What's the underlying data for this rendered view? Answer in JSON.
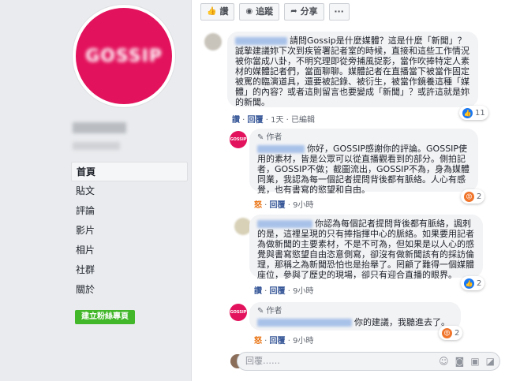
{
  "sidebar": {
    "logo_text": "GOSSIP",
    "items": [
      {
        "label": "首頁"
      },
      {
        "label": "貼文"
      },
      {
        "label": "評論"
      },
      {
        "label": "影片"
      },
      {
        "label": "相片"
      },
      {
        "label": "社群"
      },
      {
        "label": "關於"
      }
    ],
    "create_button": "建立粉絲專頁"
  },
  "toolbar": {
    "like": "讚",
    "follow": "追蹤",
    "share": "分享",
    "more": "···"
  },
  "comments": [
    {
      "text": "請問Gossip是什麼媒體？這是什麼「新聞」？誠摯建議妳下次到疾管署記者室的時候，直接和這些工作情況被你當成八卦，不明究理即從旁捕風捉影，當作吹捧特定人素材的媒體記者們，當面聊聊。媒體記者在直播當下被當作固定被罵的臨演道具，還要被記錄、被衍生，被當作鏡養這種「媒體」的內容？或者這則留言也要變成「新聞」？或許這就是妳的新聞。",
      "meta_like": "讚",
      "meta_reply": "回覆",
      "meta_time": "1天",
      "meta_edited": "已編輯",
      "reaction_count": "11"
    },
    {
      "author_label": "作者",
      "text": "你好，GOSSIP感謝你的評論。GOSSIP使用的素材，皆是公眾可以從直播觀看到的部分。側拍記者，GOSSIP不做；截圖流出，GOSSIP不為，身為媒體同業，我認為每一個記者提問背後都有脈絡。人心有感覺，也有書寫的慾望和自由。",
      "meta_like": "怒",
      "meta_reply": "回覆",
      "meta_time": "9小時",
      "reaction_count": "2"
    },
    {
      "text": "你認為每個記者提問背後都有脈絡，諷刺的是，這裡呈現的只有捧指揮中心的脈絡。如果要用記者為做新聞的主要素材，不是不可為，但如果是以人心的感覺與書寫慾望自由恣意側寫，卻沒有做新聞該有的採訪倫理，那稱之為新聞恐怕也是抬舉了。罔顧了難得一個媒體座位，參與了歷史的現場，卻只有迎合直播的眼界。",
      "meta_like": "讚",
      "meta_reply": "回覆",
      "meta_time": "9小時",
      "reaction_count": "2"
    },
    {
      "author_label": "作者",
      "text": "你的建議，我聽進去了。",
      "meta_like": "怒",
      "meta_reply": "回覆",
      "meta_time": "9小時",
      "reaction_count": "2"
    }
  ],
  "reply_box": {
    "placeholder": "回覆……"
  },
  "colors": {
    "brand": "#e3125c",
    "link": "#385898",
    "button_green": "#42b72a"
  }
}
